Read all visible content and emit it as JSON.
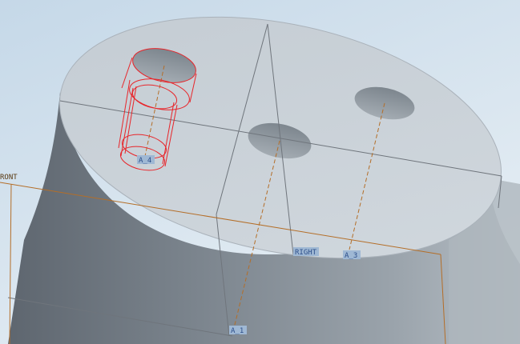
{
  "viewport": {
    "background_top": "#c9dbe9",
    "background_bottom": "#e3ecf3",
    "datum_plane_color": "#b46e28",
    "axis_color": "#b46e28",
    "edge_color": "#7a7f86",
    "selection_color": "#e8252a",
    "label_color": "#2d4f8a",
    "label_bg": "#9fb8d4"
  },
  "model": {
    "top_face_color": "#cbd2d8",
    "side_face_dark": "#6d757e",
    "side_face_light": "#a9b1b9",
    "hole_color": "#8b949c"
  },
  "datum_labels": {
    "front": "RONT",
    "right": "RIGHT",
    "axis_a1": "A_1",
    "axis_a3": "A_3",
    "axis_a4": "A_4"
  }
}
